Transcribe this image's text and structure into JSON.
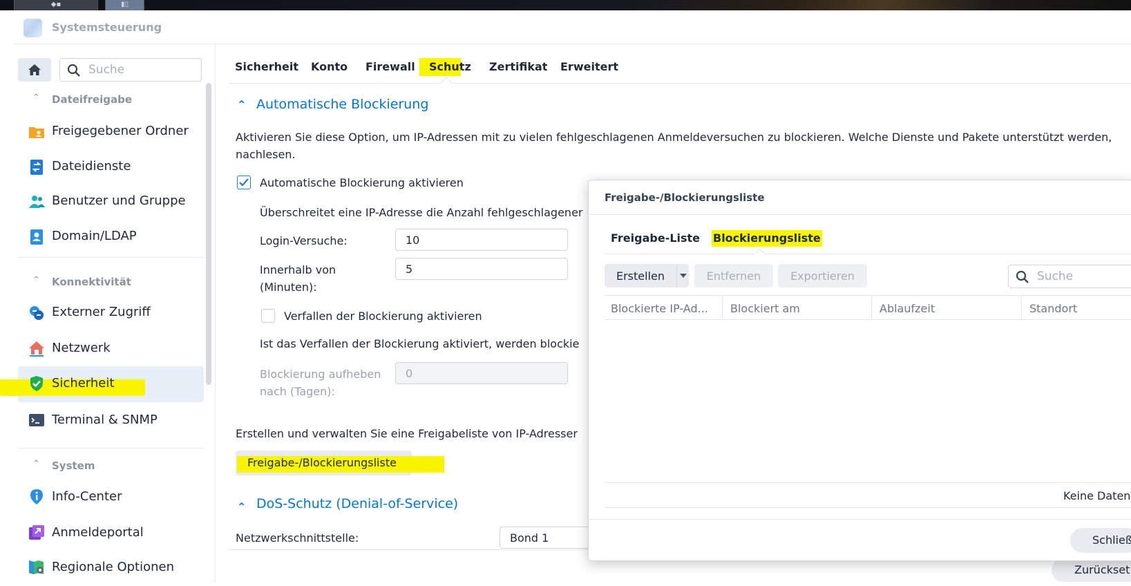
{
  "app": {
    "title": "Systemsteuerung"
  },
  "sidebar": {
    "search_placeholder": "Suche",
    "groups": [
      {
        "label": "Dateifreigabe"
      },
      {
        "label": "Konnektivität"
      },
      {
        "label": "System"
      }
    ],
    "items": [
      {
        "label": "Freigegebener Ordner",
        "icon": "folder-share-icon"
      },
      {
        "label": "Dateidienste",
        "icon": "file-services-icon"
      },
      {
        "label": "Benutzer und Gruppe",
        "icon": "users-icon"
      },
      {
        "label": "Domain/LDAP",
        "icon": "domain-icon"
      },
      {
        "label": "Externer Zugriff",
        "icon": "external-access-icon"
      },
      {
        "label": "Netzwerk",
        "icon": "network-house-icon"
      },
      {
        "label": "Sicherheit",
        "icon": "security-shield-icon",
        "selected": true
      },
      {
        "label": "Terminal & SNMP",
        "icon": "terminal-icon"
      },
      {
        "label": "Info-Center",
        "icon": "info-icon"
      },
      {
        "label": "Anmeldeportal",
        "icon": "login-portal-icon"
      },
      {
        "label": "Regionale Optionen",
        "icon": "regional-options-icon"
      }
    ]
  },
  "tabs": [
    "Sicherheit",
    "Konto",
    "Firewall",
    "Schutz",
    "Zertifikat",
    "Erweitert"
  ],
  "active_tab": "Schutz",
  "auto_block": {
    "title": "Automatische Blockierung",
    "description_line1": "Aktivieren Sie diese Option, um IP-Adressen mit zu vielen fehlgeschlagenen Anmeldeversuchen zu blockieren. Welche Dienste und Pakete unterstützt werden,",
    "description_line2": "nachlesen.",
    "enable_label": "Automatische Blockierung aktivieren",
    "enable_checked": true,
    "threshold_text": "Überschreitet eine IP-Adresse die Anzahl fehlgeschlagener",
    "login_attempts_label": "Login-Versuche:",
    "login_attempts_value": "10",
    "within_label_line1": "Innerhalb von",
    "within_label_line2": "(Minuten):",
    "within_value": "5",
    "expire_label": "Verfallen der Blockierung aktivieren",
    "expire_checked": false,
    "expire_text": "Ist das Verfallen der Blockierung aktiviert, werden blockie",
    "unblock_label_line1": "Blockierung aufheben",
    "unblock_label_line2": "nach (Tagen):",
    "unblock_value": "0",
    "allowlist_text": "Erstellen und verwalten Sie eine Freigabeliste von IP-Adresser",
    "allowlist_button": "Freigabe-/Blockierungsliste"
  },
  "dos": {
    "title": "DoS-Schutz (Denial-of-Service)",
    "interface_label": "Netzwerkschnittstelle:",
    "interface_value": "Bond 1"
  },
  "dialog": {
    "title": "Freigabe-/Blockierungsliste",
    "tabs": [
      "Freigabe-Liste",
      "Blockierungsliste"
    ],
    "active_tab": "Blockierungsliste",
    "buttons": {
      "create": "Erstellen",
      "remove": "Entfernen",
      "export": "Exportieren"
    },
    "search_placeholder": "Suche",
    "columns": [
      "Blockierte IP-Ad...",
      "Blockiert am",
      "Ablaufzeit",
      "Standort"
    ],
    "empty_text": "Keine Daten",
    "close_button": "Schließ"
  },
  "footer": {
    "reset_button": "Zurückset"
  },
  "colors": {
    "accent": "#0077d9",
    "highlight": "#f9f500",
    "selected_bg": "#e6eef8"
  }
}
